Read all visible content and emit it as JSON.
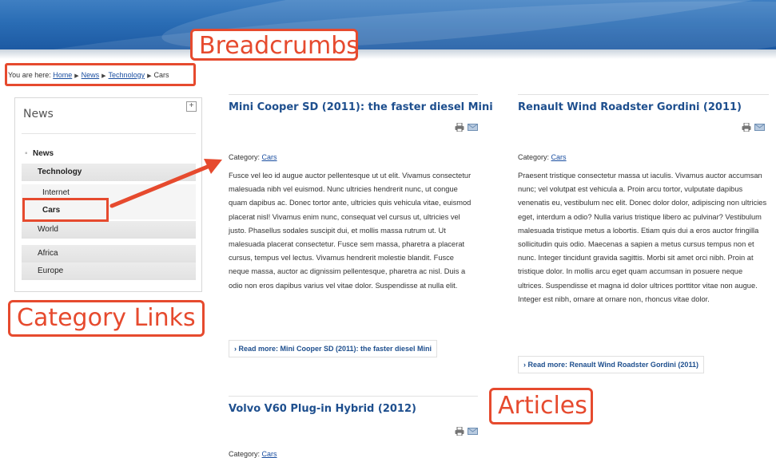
{
  "annotations": {
    "breadcrumbs": "Breadcrumbs",
    "category_links": "Category Links",
    "articles": "Articles"
  },
  "colors": {
    "header_blue": "#2a6db5",
    "accent_red": "#e64a2e",
    "title_blue": "#1e4f8e",
    "link_blue": "#1a4ea0"
  },
  "breadcrumbs": {
    "prefix": "You are here:",
    "items": [
      "Home",
      "News",
      "Technology"
    ],
    "current": "Cars"
  },
  "sidebar": {
    "title": "News",
    "toggle": "+",
    "items": [
      {
        "label": "News",
        "level": 0
      },
      {
        "label": "Technology",
        "level": 1
      },
      {
        "label": "Internet",
        "level": 2
      },
      {
        "label": "Cars",
        "level": 2,
        "active": true
      },
      {
        "label": "World",
        "level": 1
      },
      {
        "label": "Africa",
        "level": 1
      },
      {
        "label": "Europe",
        "level": 1
      }
    ]
  },
  "articles": [
    {
      "title": "Mini Cooper SD (2011): the faster diesel Mini",
      "category_label": "Category:",
      "category": "Cars",
      "body": "Fusce vel leo id augue auctor pellentesque ut ut elit. Vivamus consectetur malesuada nibh vel euismod. Nunc ultricies hendrerit nunc, ut congue quam dapibus ac. Donec tortor ante, ultricies quis vehicula vitae, euismod placerat nisl! Vivamus enim nunc, consequat vel cursus ut, ultricies vel justo. Phasellus sodales suscipit dui, et mollis massa rutrum ut. Ut malesuada placerat consectetur. Fusce sem massa, pharetra a placerat cursus, tempus vel lectus. Vivamus hendrerit molestie blandit. Fusce neque massa, auctor ac dignissim pellentesque, pharetra ac nisl. Duis a odio non eros dapibus varius vel vitae dolor. Suspendisse at nulla elit.",
      "read_more": "› Read more: Mini Cooper SD (2011): the faster diesel Mini"
    },
    {
      "title": "Renault Wind Roadster Gordini (2011)",
      "category_label": "Category:",
      "category": "Cars",
      "body": "Praesent tristique consectetur massa ut iaculis. Vivamus auctor accumsan nunc; vel volutpat est vehicula a. Proin arcu tortor, vulputate dapibus venenatis eu, vestibulum nec elit. Donec dolor dolor, adipiscing non ultricies eget, interdum a odio? Nulla varius tristique libero ac pulvinar? Vestibulum malesuada tristique metus a lobortis. Etiam quis dui a eros auctor fringilla sollicitudin quis odio. Maecenas a sapien a metus cursus tempus non et nunc. Integer tincidunt gravida sagittis. Morbi sit amet orci nibh. Proin at tristique dolor. In mollis arcu eget quam accumsan in posuere neque ultrices. Suspendisse et magna id dolor ultrices porttitor vitae non augue. Integer est nibh, ornare at ornare non, rhoncus vitae dolor.",
      "read_more": "› Read more: Renault Wind Roadster Gordini (2011)"
    },
    {
      "title": "Volvo V60 Plug-in Hybrid (2012)",
      "category_label": "Category:",
      "category": "Cars"
    }
  ],
  "icons": {
    "print": "print-icon",
    "email": "email-icon"
  }
}
